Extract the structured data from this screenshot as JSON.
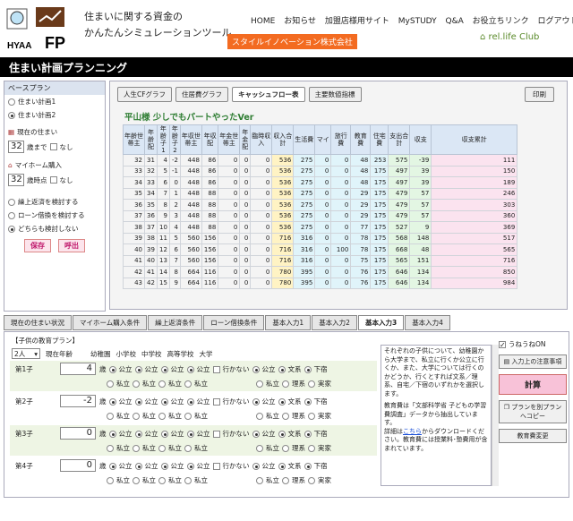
{
  "brand": {
    "logo_text": "HYAA FP",
    "tagline1": "住まいに関する資金の",
    "tagline2": "かんたんシミュレーションツール",
    "company": "スタイルイノベーション株式会社",
    "partner": "rel.life Club"
  },
  "topnav": [
    "HOME",
    "お知らせ",
    "加盟店様用サイト",
    "MySTUDY",
    "Q&A",
    "お役立ちリンク",
    "ログアウト"
  ],
  "page_title": "住まい計画プランニング",
  "left": {
    "base_plan": "ベースプラン",
    "plan1": "住まい計画1",
    "plan2": "住まい計画2",
    "current_home": "現在の住まい",
    "current_age": "32",
    "age_until": "歳まで",
    "none": "なし",
    "myhome": "マイホーム購入",
    "buy_age": "32",
    "buy_unit": "歳時点",
    "opt1": "繰上返済を検討する",
    "opt2": "ローン借換を検討する",
    "opt3": "どちらも検討しない",
    "save": "保存",
    "call": "呼出"
  },
  "tabs": [
    "人生CFグラフ",
    "住居費グラフ",
    "キャッシュフロー表",
    "主要数値指標"
  ],
  "print": "印刷",
  "subtitle": "平山様 少しでもパートやったVer",
  "table": {
    "headers": [
      "年齢世帯主",
      "年齢配",
      "年齢子1",
      "年齢子2",
      "年収世帯主",
      "年収配",
      "年金世帯主",
      "年金配",
      "臨時収入",
      "収入合計",
      "生活費",
      "マイ",
      "旅行費",
      "教育費",
      "住宅費",
      "支出合計",
      "収支",
      "収支累計"
    ],
    "rows": [
      [
        "32",
        "31",
        "4",
        "-2",
        "448",
        "86",
        "0",
        "0",
        "0",
        "536",
        "275",
        "0",
        "0",
        "48",
        "253",
        "575",
        "-39",
        "111"
      ],
      [
        "33",
        "32",
        "5",
        "-1",
        "448",
        "86",
        "0",
        "0",
        "0",
        "536",
        "275",
        "0",
        "0",
        "48",
        "175",
        "497",
        "39",
        "150"
      ],
      [
        "34",
        "33",
        "6",
        "0",
        "448",
        "86",
        "0",
        "0",
        "0",
        "536",
        "275",
        "0",
        "0",
        "48",
        "175",
        "497",
        "39",
        "189"
      ],
      [
        "35",
        "34",
        "7",
        "1",
        "448",
        "88",
        "0",
        "0",
        "0",
        "536",
        "275",
        "0",
        "0",
        "29",
        "175",
        "479",
        "57",
        "246"
      ],
      [
        "36",
        "35",
        "8",
        "2",
        "448",
        "88",
        "0",
        "0",
        "0",
        "536",
        "275",
        "0",
        "0",
        "29",
        "175",
        "479",
        "57",
        "303"
      ],
      [
        "37",
        "36",
        "9",
        "3",
        "448",
        "88",
        "0",
        "0",
        "0",
        "536",
        "275",
        "0",
        "0",
        "29",
        "175",
        "479",
        "57",
        "360"
      ],
      [
        "38",
        "37",
        "10",
        "4",
        "448",
        "88",
        "0",
        "0",
        "0",
        "536",
        "275",
        "0",
        "0",
        "77",
        "175",
        "527",
        "9",
        "369"
      ],
      [
        "39",
        "38",
        "11",
        "5",
        "560",
        "156",
        "0",
        "0",
        "0",
        "716",
        "316",
        "0",
        "0",
        "78",
        "175",
        "568",
        "148",
        "517"
      ],
      [
        "40",
        "39",
        "12",
        "6",
        "560",
        "156",
        "0",
        "0",
        "0",
        "716",
        "316",
        "0",
        "100",
        "78",
        "175",
        "668",
        "48",
        "565"
      ],
      [
        "41",
        "40",
        "13",
        "7",
        "560",
        "156",
        "0",
        "0",
        "0",
        "716",
        "316",
        "0",
        "0",
        "75",
        "175",
        "565",
        "151",
        "716"
      ],
      [
        "42",
        "41",
        "14",
        "8",
        "664",
        "116",
        "0",
        "0",
        "0",
        "780",
        "395",
        "0",
        "0",
        "76",
        "175",
        "646",
        "134",
        "850"
      ],
      [
        "43",
        "42",
        "15",
        "9",
        "664",
        "116",
        "0",
        "0",
        "0",
        "780",
        "395",
        "0",
        "0",
        "76",
        "175",
        "646",
        "134",
        "984"
      ]
    ]
  },
  "bottom_tabs": [
    "現在の住まい状況",
    "マイホーム購入条件",
    "繰上返済条件",
    "ローン借換条件",
    "基本入力1",
    "基本入力2",
    "基本入力3",
    "基本入力4"
  ],
  "child": {
    "section": "【子供の教育プラン】",
    "count": "2人",
    "current_age": "現在年齢",
    "kindergarten": "幼稚園",
    "elementary": "小学校",
    "junior": "中学校",
    "high": "高等学校",
    "univ": "大学",
    "kids": [
      {
        "name": "第1子",
        "age": "4"
      },
      {
        "name": "第2子",
        "age": "-2"
      },
      {
        "name": "第3子",
        "age": "0"
      },
      {
        "name": "第4子",
        "age": "0"
      }
    ],
    "unit": "歳",
    "public": "公立",
    "private": "私立",
    "notgo": "行かない",
    "bunkei": "文系",
    "rikei": "理系",
    "geshuku": "下宿",
    "jitaku": "実家"
  },
  "info": {
    "text1": "それぞれの子供について、幼稚園から大学まで、私立に行くか公立に行くか、また、大学については行くのかどうか、行くとすれば文系／理系、自宅／下宿のいずれかを選択します。",
    "text2": "教育費は「文部科学省 子どもの学習費調査」データから抽出しています。",
    "text3a": "詳細は",
    "link": "こちら",
    "text3b": "からダウンロードください。教育費には授業料･塾費用が含まれています。"
  },
  "right": {
    "uneune": "うねうねON",
    "input_guide": "入力上の注意事項",
    "calc": "計算",
    "copy": "プランを別プランへコピー",
    "edu_change": "教育費変更"
  }
}
